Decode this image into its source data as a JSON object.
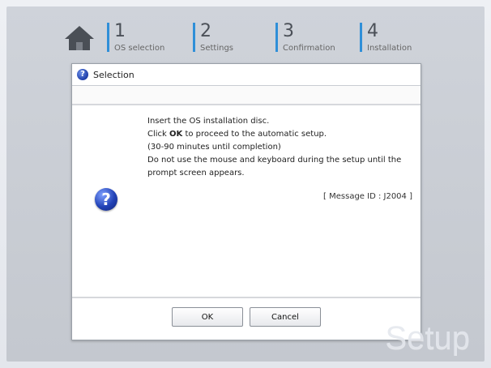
{
  "header": {
    "home_icon": "house-icon",
    "steps": [
      {
        "num": "1",
        "label": "OS selection"
      },
      {
        "num": "2",
        "label": "Settings"
      },
      {
        "num": "3",
        "label": "Confirmation"
      },
      {
        "num": "4",
        "label": "Installation"
      }
    ],
    "accent_color": "#2f8fd8"
  },
  "dialog": {
    "title": "Selection",
    "title_icon": "question-icon",
    "message": {
      "line1": "Insert the OS installation disc.",
      "line2_pre": "Click ",
      "line2_bold": "OK",
      "line2_post": " to proceed to the automatic setup.",
      "line3": "(30-90 minutes until completion)",
      "line4": "Do not use the mouse and keyboard during the setup until the",
      "line5": "prompt screen appears."
    },
    "message_id": "[ Message ID : J2004 ]",
    "big_icon": "question-icon",
    "buttons": {
      "ok": "OK",
      "cancel": "Cancel"
    }
  },
  "watermark": "Setup"
}
